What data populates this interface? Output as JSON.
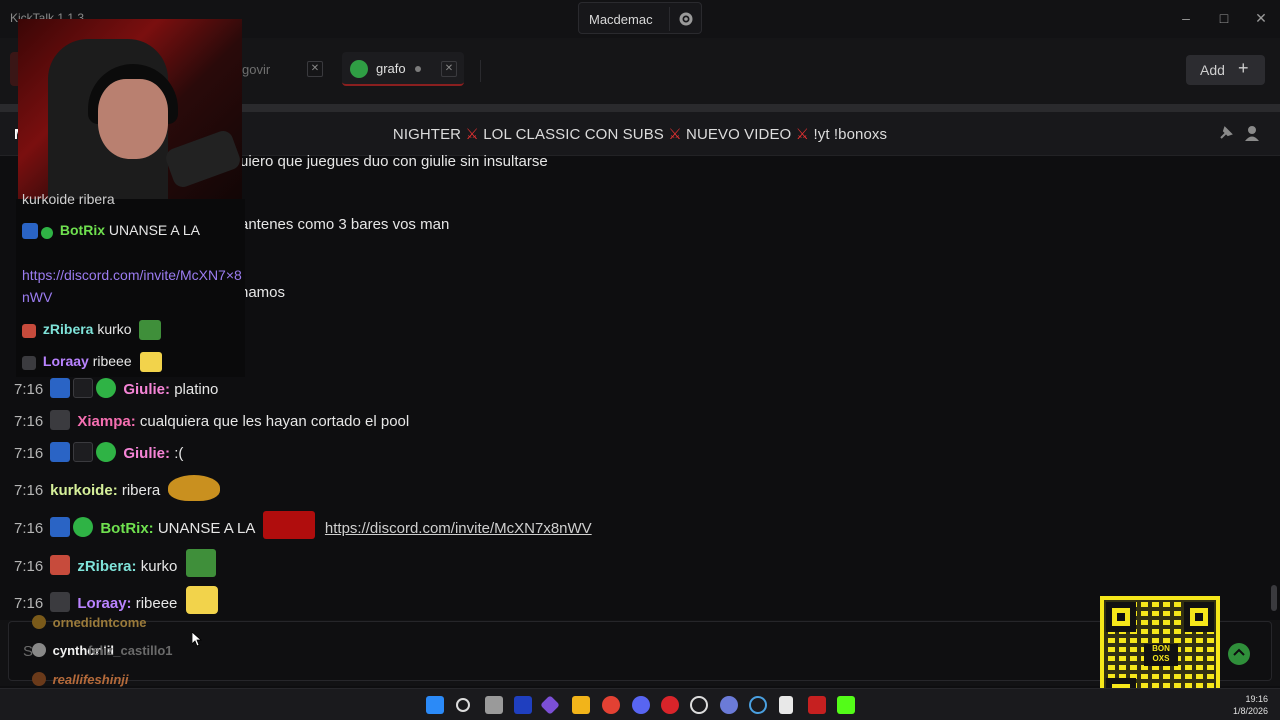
{
  "app": {
    "title": "KickTalk 1.1.3"
  },
  "user": {
    "name": "Macdemac"
  },
  "tabs": [
    {
      "label": "govir"
    },
    {
      "label": "grafo"
    }
  ],
  "add_button": {
    "label": "Add"
  },
  "header": {
    "left_initial": "M",
    "stream_title": {
      "part1": "NIGHTER",
      "part2": "LOL CLASSIC CON SUBS",
      "part3": "NUEVO VIDEO",
      "part4": "!yt !bonoxs"
    }
  },
  "partial_messages": [
    "uiero que juegues duo con giulie sin insultarse",
    "antenes como 3 bares vos man",
    "namos"
  ],
  "messages": [
    {
      "time": "7:16",
      "user": "Giulie:",
      "text": "platino",
      "user_color": "#f584d6"
    },
    {
      "time": "7:16",
      "user": "Xiampa:",
      "text": "cualquiera que les hayan cortado el pool",
      "user_color": "#f56fb1"
    },
    {
      "time": "7:16",
      "user": "Giulie:",
      "text": ":(",
      "user_color": "#f584d6"
    },
    {
      "time": "7:16",
      "user": "kurkoide:",
      "text": "ribera",
      "user_color": "#d6f09a"
    },
    {
      "time": "7:16",
      "user": "BotRix:",
      "text": "UNANSE A LA",
      "link": "https://discord.com/invite/McXN7x8nWV",
      "user_color": "#6fe04f"
    },
    {
      "time": "7:16",
      "user": "zRibera:",
      "text": "kurko",
      "user_color": "#7fe3d9"
    },
    {
      "time": "7:16",
      "user": "Loraay:",
      "text": "ribeee",
      "user_color": "#b983ff"
    }
  ],
  "overlay": {
    "top_partial": "kurkoide ribera",
    "botrix_user": "BotRix",
    "botrix_text": "UNANSE A LA",
    "botrix_link": "https://discord.com/invite/McXN7×8nWV",
    "zribera_user": "zRibera",
    "zribera_text": "kurko",
    "loraay_user": "Loraay",
    "loraay_text": "ribeee"
  },
  "input": {
    "stacked_names": [
      "ornedidntcome",
      "cynthonlil",
      "feliz_castillo1",
      "reallifeshinji"
    ],
    "placeholder_partial": "S"
  },
  "qr": {
    "brand": "BON OXS"
  },
  "taskbar": {
    "time": "19:16",
    "date": "1/8/2026"
  },
  "colors": {
    "accent_red": "#e03131",
    "kick_green": "#53fc18"
  }
}
